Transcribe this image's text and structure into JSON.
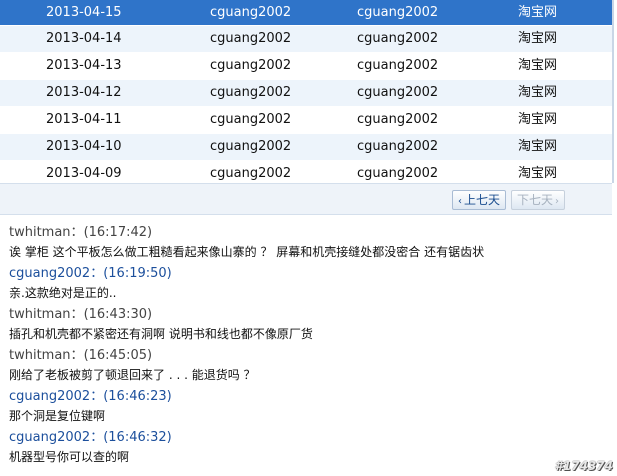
{
  "table": {
    "rows": [
      {
        "date": "2013-04-15",
        "buyer": "cguang2002",
        "seller": "cguang2002",
        "site": "淘宝网"
      },
      {
        "date": "2013-04-14",
        "buyer": "cguang2002",
        "seller": "cguang2002",
        "site": "淘宝网"
      },
      {
        "date": "2013-04-13",
        "buyer": "cguang2002",
        "seller": "cguang2002",
        "site": "淘宝网"
      },
      {
        "date": "2013-04-12",
        "buyer": "cguang2002",
        "seller": "cguang2002",
        "site": "淘宝网"
      },
      {
        "date": "2013-04-11",
        "buyer": "cguang2002",
        "seller": "cguang2002",
        "site": "淘宝网"
      },
      {
        "date": "2013-04-10",
        "buyer": "cguang2002",
        "seller": "cguang2002",
        "site": "淘宝网"
      },
      {
        "date": "2013-04-09",
        "buyer": "cguang2002",
        "seller": "cguang2002",
        "site": "淘宝网"
      }
    ]
  },
  "pager": {
    "prev_label": "上七天",
    "next_label": "下七天",
    "prev_arrow": "‹",
    "next_arrow": "›"
  },
  "chat": [
    {
      "user": "twhitman",
      "time": "(16:17:42)",
      "text": "诶 掌柜 这个平板怎么做工粗糙看起来像山寨的 ？ 屏幕和机壳接缝处都没密合 还有锯齿状"
    },
    {
      "user": "cguang2002",
      "time": "(16:19:50)",
      "text": "亲.这款绝对是正的.."
    },
    {
      "user": "twhitman",
      "time": "(16:43:30)",
      "text": "插孔和机壳都不紧密还有洞啊 说明书和线也都不像原厂货"
    },
    {
      "user": "twhitman",
      "time": "(16:45:05)",
      "text": "刚给了老板被剪了顿退回来了 . . .  能退货吗 ？"
    },
    {
      "user": "cguang2002",
      "time": "(16:46:23)",
      "text": "那个洞是复位键啊"
    },
    {
      "user": "cguang2002",
      "time": "(16:46:32)",
      "text": "机器型号你可以查的啊"
    }
  ],
  "watermark": "#174374"
}
